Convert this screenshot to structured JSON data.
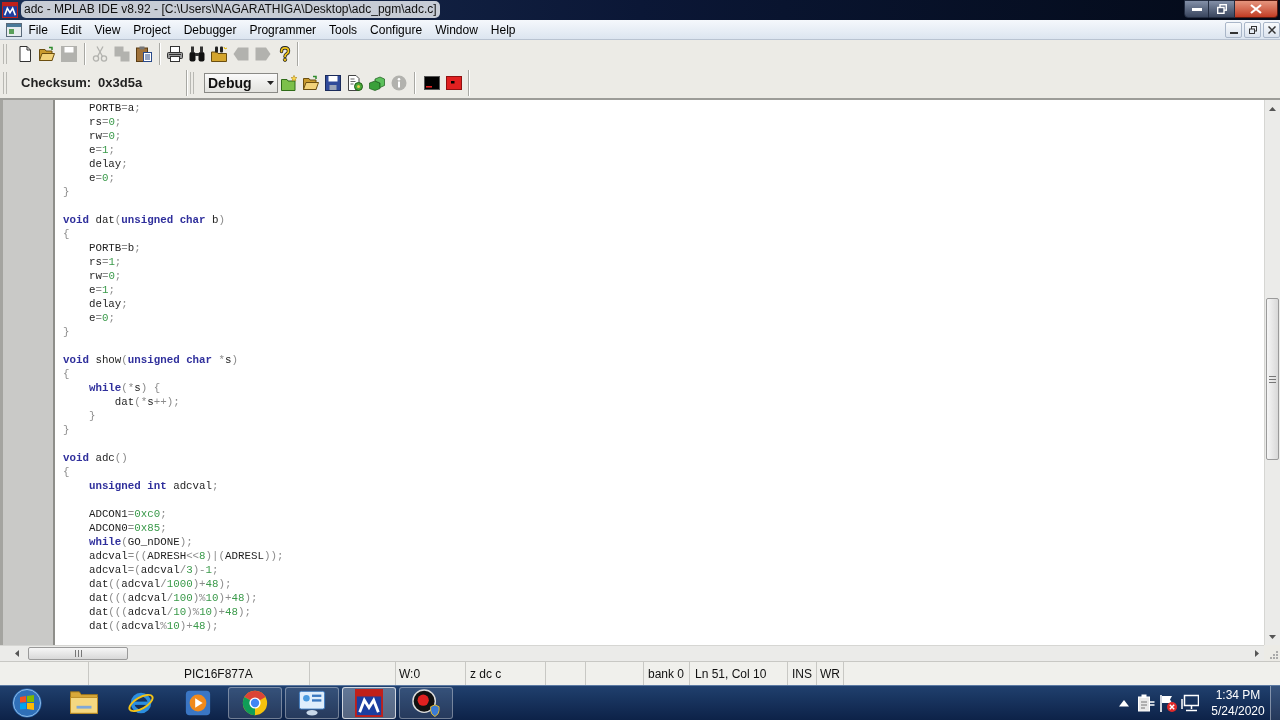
{
  "window": {
    "title": "adc - MPLAB IDE v8.92 - [C:\\Users\\NAGARATHIGA\\Desktop\\adc_pgm\\adc.c]"
  },
  "menu": [
    "File",
    "Edit",
    "View",
    "Project",
    "Debugger",
    "Programmer",
    "Tools",
    "Configure",
    "Window",
    "Help"
  ],
  "toolbar_1": [
    [
      {
        "kind": "page",
        "disabled": false
      },
      {
        "kind": "folder_open",
        "disabled": false
      },
      {
        "kind": "floppy",
        "disabled": true
      }
    ],
    [
      {
        "kind": "scissors",
        "disabled": true
      },
      {
        "kind": "copy",
        "disabled": true
      },
      {
        "kind": "clipboard",
        "disabled": false
      }
    ],
    [
      {
        "kind": "printer",
        "disabled": false
      },
      {
        "kind": "binoculars",
        "disabled": false
      },
      {
        "kind": "folder_search",
        "disabled": false
      },
      {
        "kind": "arrow_left",
        "disabled": true
      },
      {
        "kind": "arrow_right",
        "disabled": true
      },
      {
        "kind": "question",
        "disabled": false
      }
    ]
  ],
  "toolbar_2": {
    "checksum_label": "Checksum:",
    "checksum_value": "0x3d5a",
    "configuration": "Debug",
    "buttons": [
      [
        {
          "kind": "folder_star",
          "disabled": false
        },
        {
          "kind": "folder_open",
          "disabled": false
        },
        {
          "kind": "floppy",
          "disabled": false
        },
        {
          "kind": "page_gear",
          "disabled": false
        },
        {
          "kind": "boxes",
          "disabled": false
        },
        {
          "kind": "info",
          "disabled": true
        }
      ],
      [
        {
          "kind": "screen_bar",
          "disabled": false
        },
        {
          "kind": "screen_dot",
          "disabled": false
        }
      ]
    ]
  },
  "editor": {
    "blocks": [
      [
        [
          {
            "text": "    PORTB",
            "kind": "id"
          },
          {
            "text": "=",
            "kind": "sym"
          },
          {
            "text": "a",
            "kind": "id"
          },
          {
            "text": ";",
            "kind": "sym"
          }
        ],
        [
          {
            "text": "    rs",
            "kind": "id"
          },
          {
            "text": "=",
            "kind": "sym"
          },
          {
            "text": "0",
            "kind": "num"
          },
          {
            "text": ";",
            "kind": "sym"
          }
        ],
        [
          {
            "text": "    rw",
            "kind": "id"
          },
          {
            "text": "=",
            "kind": "sym"
          },
          {
            "text": "0",
            "kind": "num"
          },
          {
            "text": ";",
            "kind": "sym"
          }
        ],
        [
          {
            "text": "    e",
            "kind": "id"
          },
          {
            "text": "=",
            "kind": "sym"
          },
          {
            "text": "1",
            "kind": "num"
          },
          {
            "text": ";",
            "kind": "sym"
          }
        ],
        [
          {
            "text": "    delay",
            "kind": "id"
          },
          {
            "text": ";",
            "kind": "sym"
          }
        ],
        [
          {
            "text": "    e",
            "kind": "id"
          },
          {
            "text": "=",
            "kind": "sym"
          },
          {
            "text": "0",
            "kind": "num"
          },
          {
            "text": ";",
            "kind": "sym"
          }
        ],
        [
          {
            "text": "}",
            "kind": "sym"
          }
        ]
      ],
      [
        [
          {
            "text": "void",
            "kind": "kw"
          },
          {
            "text": " dat",
            "kind": "id"
          },
          {
            "text": "(",
            "kind": "sym"
          },
          {
            "text": "unsigned char",
            "kind": "kw"
          },
          {
            "text": " b",
            "kind": "id"
          },
          {
            "text": ")",
            "kind": "sym"
          }
        ],
        [
          {
            "text": "{",
            "kind": "sym"
          }
        ],
        [
          {
            "text": "    PORTB",
            "kind": "id"
          },
          {
            "text": "=",
            "kind": "sym"
          },
          {
            "text": "b",
            "kind": "id"
          },
          {
            "text": ";",
            "kind": "sym"
          }
        ],
        [
          {
            "text": "    rs",
            "kind": "id"
          },
          {
            "text": "=",
            "kind": "sym"
          },
          {
            "text": "1",
            "kind": "num"
          },
          {
            "text": ";",
            "kind": "sym"
          }
        ],
        [
          {
            "text": "    rw",
            "kind": "id"
          },
          {
            "text": "=",
            "kind": "sym"
          },
          {
            "text": "0",
            "kind": "num"
          },
          {
            "text": ";",
            "kind": "sym"
          }
        ],
        [
          {
            "text": "    e",
            "kind": "id"
          },
          {
            "text": "=",
            "kind": "sym"
          },
          {
            "text": "1",
            "kind": "num"
          },
          {
            "text": ";",
            "kind": "sym"
          }
        ],
        [
          {
            "text": "    delay",
            "kind": "id"
          },
          {
            "text": ";",
            "kind": "sym"
          }
        ],
        [
          {
            "text": "    e",
            "kind": "id"
          },
          {
            "text": "=",
            "kind": "sym"
          },
          {
            "text": "0",
            "kind": "num"
          },
          {
            "text": ";",
            "kind": "sym"
          }
        ],
        [
          {
            "text": "}",
            "kind": "sym"
          }
        ]
      ],
      [
        [
          {
            "text": "void",
            "kind": "kw"
          },
          {
            "text": " show",
            "kind": "id"
          },
          {
            "text": "(",
            "kind": "sym"
          },
          {
            "text": "unsigned char",
            "kind": "kw"
          },
          {
            "text": " *",
            "kind": "sym"
          },
          {
            "text": "s",
            "kind": "id"
          },
          {
            "text": ")",
            "kind": "sym"
          }
        ],
        [
          {
            "text": "{",
            "kind": "sym"
          }
        ],
        [
          {
            "text": "    while",
            "kind": "kw"
          },
          {
            "text": "(*",
            "kind": "sym"
          },
          {
            "text": "s",
            "kind": "id"
          },
          {
            "text": ") {",
            "kind": "sym"
          }
        ],
        [
          {
            "text": "        dat",
            "kind": "id"
          },
          {
            "text": "(*",
            "kind": "sym"
          },
          {
            "text": "s",
            "kind": "id"
          },
          {
            "text": "++);",
            "kind": "sym"
          }
        ],
        [
          {
            "text": "    }",
            "kind": "sym"
          }
        ],
        [
          {
            "text": "}",
            "kind": "sym"
          }
        ]
      ],
      [
        [
          {
            "text": "void",
            "kind": "kw"
          },
          {
            "text": " adc",
            "kind": "id"
          },
          {
            "text": "()",
            "kind": "sym"
          }
        ],
        [
          {
            "text": "{",
            "kind": "sym"
          }
        ],
        [
          {
            "text": "    unsigned int",
            "kind": "kw"
          },
          {
            "text": " adcval",
            "kind": "id"
          },
          {
            "text": ";",
            "kind": "sym"
          }
        ]
      ],
      [
        [
          {
            "text": "    ADCON1",
            "kind": "id"
          },
          {
            "text": "=",
            "kind": "sym"
          },
          {
            "text": "0xc0",
            "kind": "num"
          },
          {
            "text": ";",
            "kind": "sym"
          }
        ],
        [
          {
            "text": "    ADCON0",
            "kind": "id"
          },
          {
            "text": "=",
            "kind": "sym"
          },
          {
            "text": "0x85",
            "kind": "num"
          },
          {
            "text": ";",
            "kind": "sym"
          }
        ],
        [
          {
            "text": "    while",
            "kind": "kw"
          },
          {
            "text": "(",
            "kind": "sym"
          },
          {
            "text": "GO_nDONE",
            "kind": "id"
          },
          {
            "text": ");",
            "kind": "sym"
          }
        ],
        [
          {
            "text": "    adcval",
            "kind": "id"
          },
          {
            "text": "=((",
            "kind": "sym"
          },
          {
            "text": "ADRESH",
            "kind": "id"
          },
          {
            "text": "<<",
            "kind": "sym"
          },
          {
            "text": "8",
            "kind": "num"
          },
          {
            "text": ")|(",
            "kind": "sym"
          },
          {
            "text": "ADRESL",
            "kind": "id"
          },
          {
            "text": "));",
            "kind": "sym"
          }
        ],
        [
          {
            "text": "    adcval",
            "kind": "id"
          },
          {
            "text": "=(",
            "kind": "sym"
          },
          {
            "text": "adcval",
            "kind": "id"
          },
          {
            "text": "/",
            "kind": "sym"
          },
          {
            "text": "3",
            "kind": "num"
          },
          {
            "text": ")-",
            "kind": "sym"
          },
          {
            "text": "1",
            "kind": "num"
          },
          {
            "text": ";",
            "kind": "sym"
          }
        ],
        [
          {
            "text": "    dat",
            "kind": "id"
          },
          {
            "text": "((",
            "kind": "sym"
          },
          {
            "text": "adcval",
            "kind": "id"
          },
          {
            "text": "/",
            "kind": "sym"
          },
          {
            "text": "1000",
            "kind": "num"
          },
          {
            "text": ")+",
            "kind": "sym"
          },
          {
            "text": "48",
            "kind": "num"
          },
          {
            "text": ");",
            "kind": "sym"
          }
        ],
        [
          {
            "text": "    dat",
            "kind": "id"
          },
          {
            "text": "(((",
            "kind": "sym"
          },
          {
            "text": "adcval",
            "kind": "id"
          },
          {
            "text": "/",
            "kind": "sym"
          },
          {
            "text": "100",
            "kind": "num"
          },
          {
            "text": ")%",
            "kind": "sym"
          },
          {
            "text": "10",
            "kind": "num"
          },
          {
            "text": ")+",
            "kind": "sym"
          },
          {
            "text": "48",
            "kind": "num"
          },
          {
            "text": ");",
            "kind": "sym"
          }
        ],
        [
          {
            "text": "    dat",
            "kind": "id"
          },
          {
            "text": "(((",
            "kind": "sym"
          },
          {
            "text": "adcval",
            "kind": "id"
          },
          {
            "text": "/",
            "kind": "sym"
          },
          {
            "text": "10",
            "kind": "num"
          },
          {
            "text": ")%",
            "kind": "sym"
          },
          {
            "text": "10",
            "kind": "num"
          },
          {
            "text": ")+",
            "kind": "sym"
          },
          {
            "text": "48",
            "kind": "num"
          },
          {
            "text": ");",
            "kind": "sym"
          }
        ],
        [
          {
            "text": "    dat",
            "kind": "id"
          },
          {
            "text": "((",
            "kind": "sym"
          },
          {
            "text": "adcval",
            "kind": "id"
          },
          {
            "text": "%",
            "kind": "sym"
          },
          {
            "text": "10",
            "kind": "num"
          },
          {
            "text": ")+",
            "kind": "sym"
          },
          {
            "text": "48",
            "kind": "num"
          },
          {
            "text": ");",
            "kind": "sym"
          }
        ]
      ]
    ]
  },
  "status_bar": {
    "device": "PIC16F877A",
    "w_register": "W:0",
    "flags": "z dc c",
    "bank": "bank 0",
    "cursor": "Ln 51, Col 10",
    "insert_mode": "INS",
    "write_mode": "WR"
  },
  "taskbar": {
    "apps": [
      {
        "kind": "folder",
        "running": false,
        "selected": false
      },
      {
        "kind": "ring_orbit",
        "running": false,
        "selected": false
      },
      {
        "kind": "play",
        "running": false,
        "selected": false
      },
      {
        "kind": "segmented_circle",
        "running": true,
        "selected": false
      },
      {
        "kind": "dashboard",
        "running": true,
        "selected": false
      },
      {
        "kind": "app_logo",
        "running": true,
        "selected": true
      },
      {
        "kind": "record",
        "running": true,
        "selected": false
      }
    ],
    "tray": [
      {
        "kind": "caret"
      },
      {
        "kind": "device"
      },
      {
        "kind": "flag"
      },
      {
        "kind": "monitor"
      }
    ],
    "time": "1:34 PM",
    "date": "5/24/2020"
  }
}
